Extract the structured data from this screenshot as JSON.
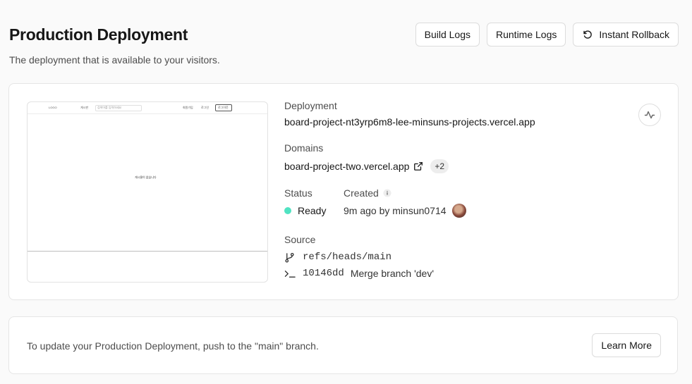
{
  "header": {
    "title": "Production Deployment",
    "subtitle": "The deployment that is available to your visitors."
  },
  "actions": {
    "build_logs": "Build Logs",
    "runtime_logs": "Runtime Logs",
    "instant_rollback": "Instant Rollback"
  },
  "preview": {
    "nav_items": [
      "LOGO",
      "게시판",
      "검색어를 입력하세요",
      "회원가입",
      "로그인",
      "로그아웃"
    ],
    "center_text": "게시물이 없습니다"
  },
  "deployment": {
    "label": "Deployment",
    "url": "board-project-nt3yrp6m8-lee-minsuns-projects.vercel.app"
  },
  "domains": {
    "label": "Domains",
    "primary": "board-project-two.vercel.app",
    "extra_count": "+2"
  },
  "status": {
    "label": "Status",
    "value": "Ready",
    "color": "#50e3c2"
  },
  "created": {
    "label": "Created",
    "value": "9m ago by minsun0714"
  },
  "source": {
    "label": "Source",
    "branch": "refs/heads/main",
    "commit_hash": "10146dd",
    "commit_message": "Merge branch 'dev'"
  },
  "footer": {
    "message": "To update your Production Deployment, push to the \"main\" branch.",
    "learn_more": "Learn More"
  }
}
